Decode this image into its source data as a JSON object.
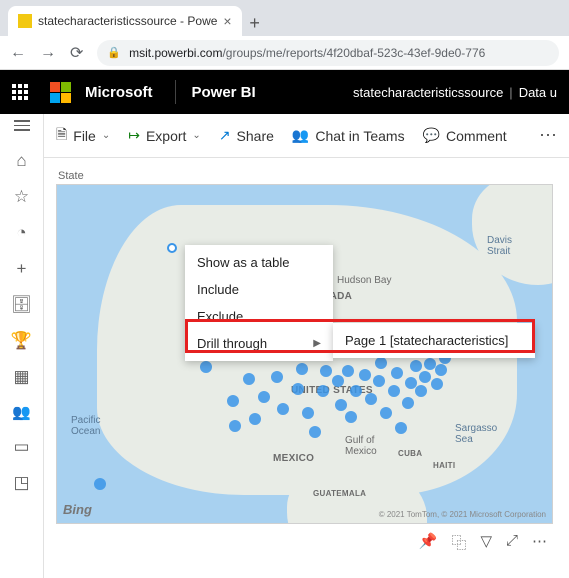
{
  "browser": {
    "tab_title": "statecharacteristicssource - Powe",
    "url_host": "msit.powerbi.com",
    "url_path": "/groups/me/reports/4f20dbaf-523c-43ef-9de0-776"
  },
  "header": {
    "ms_label": "Microsoft",
    "app_label": "Power BI",
    "breadcrumb_1": "statecharacteristicssource",
    "breadcrumb_2": "Data u"
  },
  "toolbar": {
    "file": "File",
    "export": "Export",
    "share": "Share",
    "chat": "Chat in Teams",
    "comment": "Comment"
  },
  "visual": {
    "title": "State"
  },
  "map_labels": {
    "canada": "CANADA",
    "us": "UNITED STATES",
    "mexico": "MEXICO",
    "guatemala": "GUATEMALA",
    "cuba": "CUBA",
    "haiti": "HAITI",
    "hudson": "Hudson Bay",
    "gulf": "Gulf of\nMexico",
    "pacific": "Pacific\nOcean",
    "sargasso": "Sargasso\nSea",
    "davis": "Davis\nStrait",
    "bing": "Bing",
    "attribution": "© 2021 TomTom, © 2021 Microsoft Corporation"
  },
  "context_menu": {
    "show_table": "Show as a table",
    "include": "Include",
    "exclude": "Exclude",
    "drill_through": "Drill through",
    "drill_target": "Page 1 [statecharacteristics]"
  }
}
